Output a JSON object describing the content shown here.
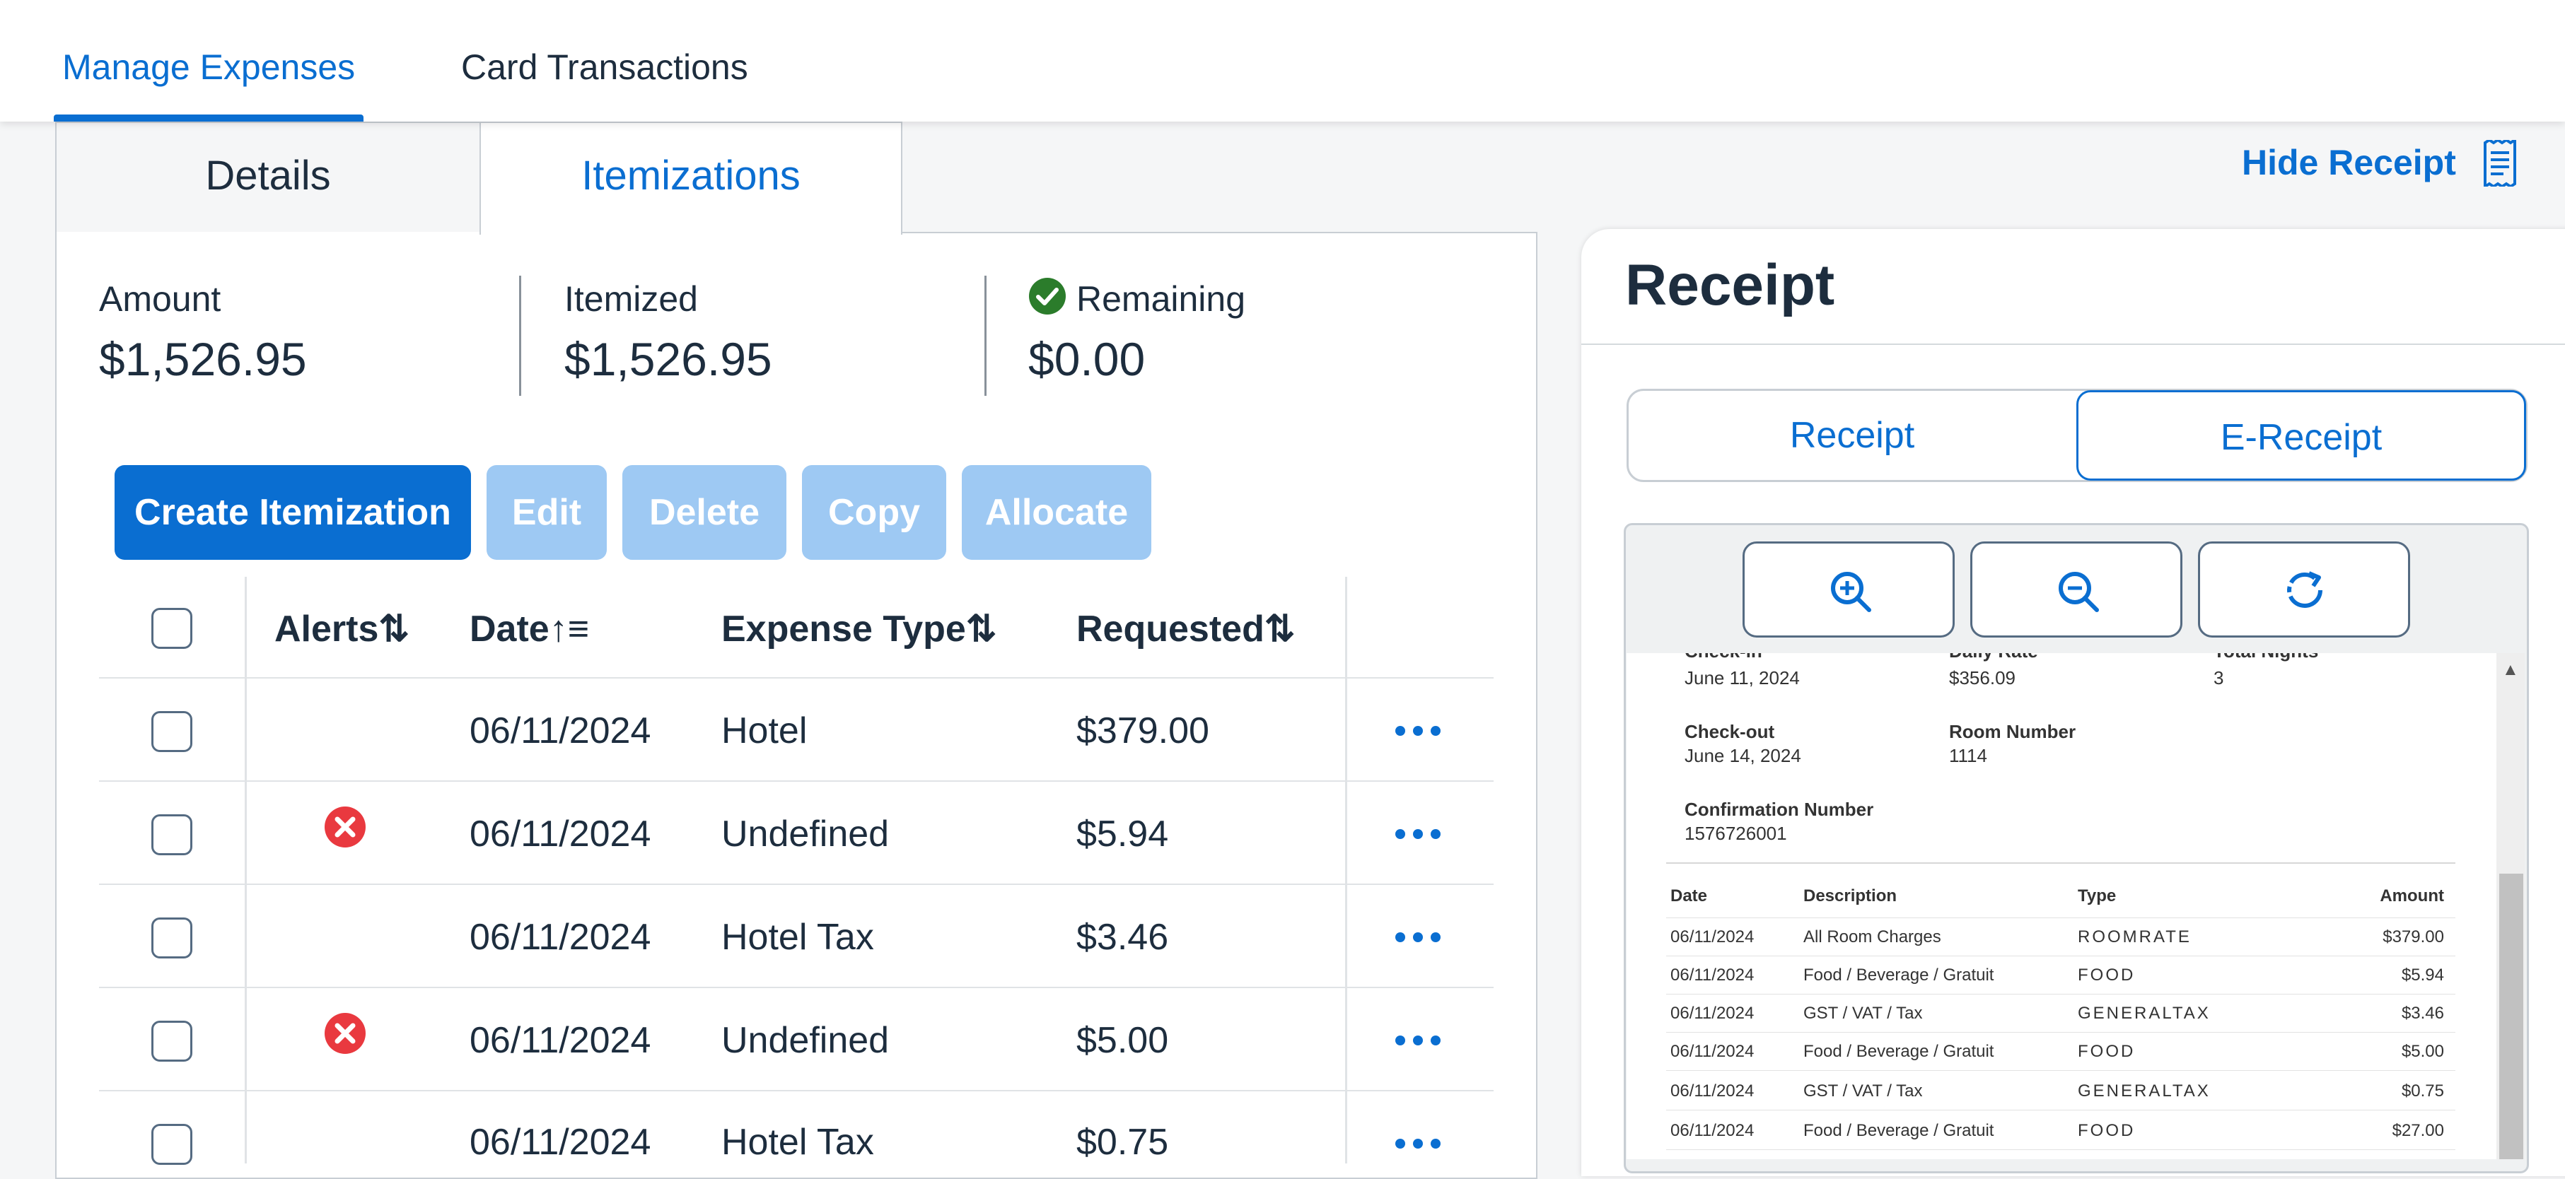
{
  "topnav": {
    "tabs": [
      {
        "label": "Manage Expenses",
        "active": true
      },
      {
        "label": "Card Transactions",
        "active": false
      }
    ]
  },
  "subtabs": {
    "details": "Details",
    "itemizations": "Itemizations"
  },
  "hide_receipt": "Hide Receipt",
  "summary": {
    "amount_label": "Amount",
    "amount_value": "$1,526.95",
    "itemized_label": "Itemized",
    "itemized_value": "$1,526.95",
    "remaining_label": "Remaining",
    "remaining_value": "$0.00"
  },
  "actions": {
    "create": "Create Itemization",
    "edit": "Edit",
    "delete": "Delete",
    "copy": "Copy",
    "allocate": "Allocate"
  },
  "table": {
    "headers": {
      "alerts": "Alerts",
      "date": "Date",
      "expense_type": "Expense Type",
      "requested": "Requested"
    },
    "rows": [
      {
        "date": "06/11/2024",
        "type": "Hotel",
        "requested": "$379.00",
        "alert": false
      },
      {
        "date": "06/11/2024",
        "type": "Undefined",
        "requested": "$5.94",
        "alert": true
      },
      {
        "date": "06/11/2024",
        "type": "Hotel Tax",
        "requested": "$3.46",
        "alert": false
      },
      {
        "date": "06/11/2024",
        "type": "Undefined",
        "requested": "$5.00",
        "alert": true
      },
      {
        "date": "06/11/2024",
        "type": "Hotel Tax",
        "requested": "$0.75",
        "alert": false
      }
    ]
  },
  "receipt": {
    "title": "Receipt",
    "segments": {
      "receipt": "Receipt",
      "ereceipt": "E-Receipt"
    },
    "document": {
      "check_in_label": "Check-in",
      "check_in_value": "June 11, 2024",
      "daily_rate_label": "Daily Rate",
      "daily_rate_value": "$356.09",
      "total_nights_label": "Total Nights",
      "total_nights_value": "3",
      "check_out_label": "Check-out",
      "check_out_value": "June 14, 2024",
      "room_number_label": "Room Number",
      "room_number_value": "1114",
      "confirmation_label": "Confirmation Number",
      "confirmation_value": "1576726001",
      "headers": {
        "date": "Date",
        "description": "Description",
        "type": "Type",
        "amount": "Amount"
      },
      "lines": [
        {
          "date": "06/11/2024",
          "description": "All Room Charges",
          "type": "ROOMRATE",
          "amount": "$379.00"
        },
        {
          "date": "06/11/2024",
          "description": "Food / Beverage / Gratuit",
          "type": "FOOD",
          "amount": "$5.94"
        },
        {
          "date": "06/11/2024",
          "description": "GST / VAT / Tax",
          "type": "GENERALTAX",
          "amount": "$3.46"
        },
        {
          "date": "06/11/2024",
          "description": "Food / Beverage / Gratuit",
          "type": "FOOD",
          "amount": "$5.00"
        },
        {
          "date": "06/11/2024",
          "description": "GST / VAT / Tax",
          "type": "GENERALTAX",
          "amount": "$0.75"
        },
        {
          "date": "06/11/2024",
          "description": "Food / Beverage / Gratuit",
          "type": "FOOD",
          "amount": "$27.00"
        }
      ]
    }
  },
  "colors": {
    "accent": "#0a6ed1",
    "accent_disabled": "#9ec9f3",
    "error": "#e9393f",
    "success": "#2b7c2b",
    "text": "#1d2d3e"
  }
}
